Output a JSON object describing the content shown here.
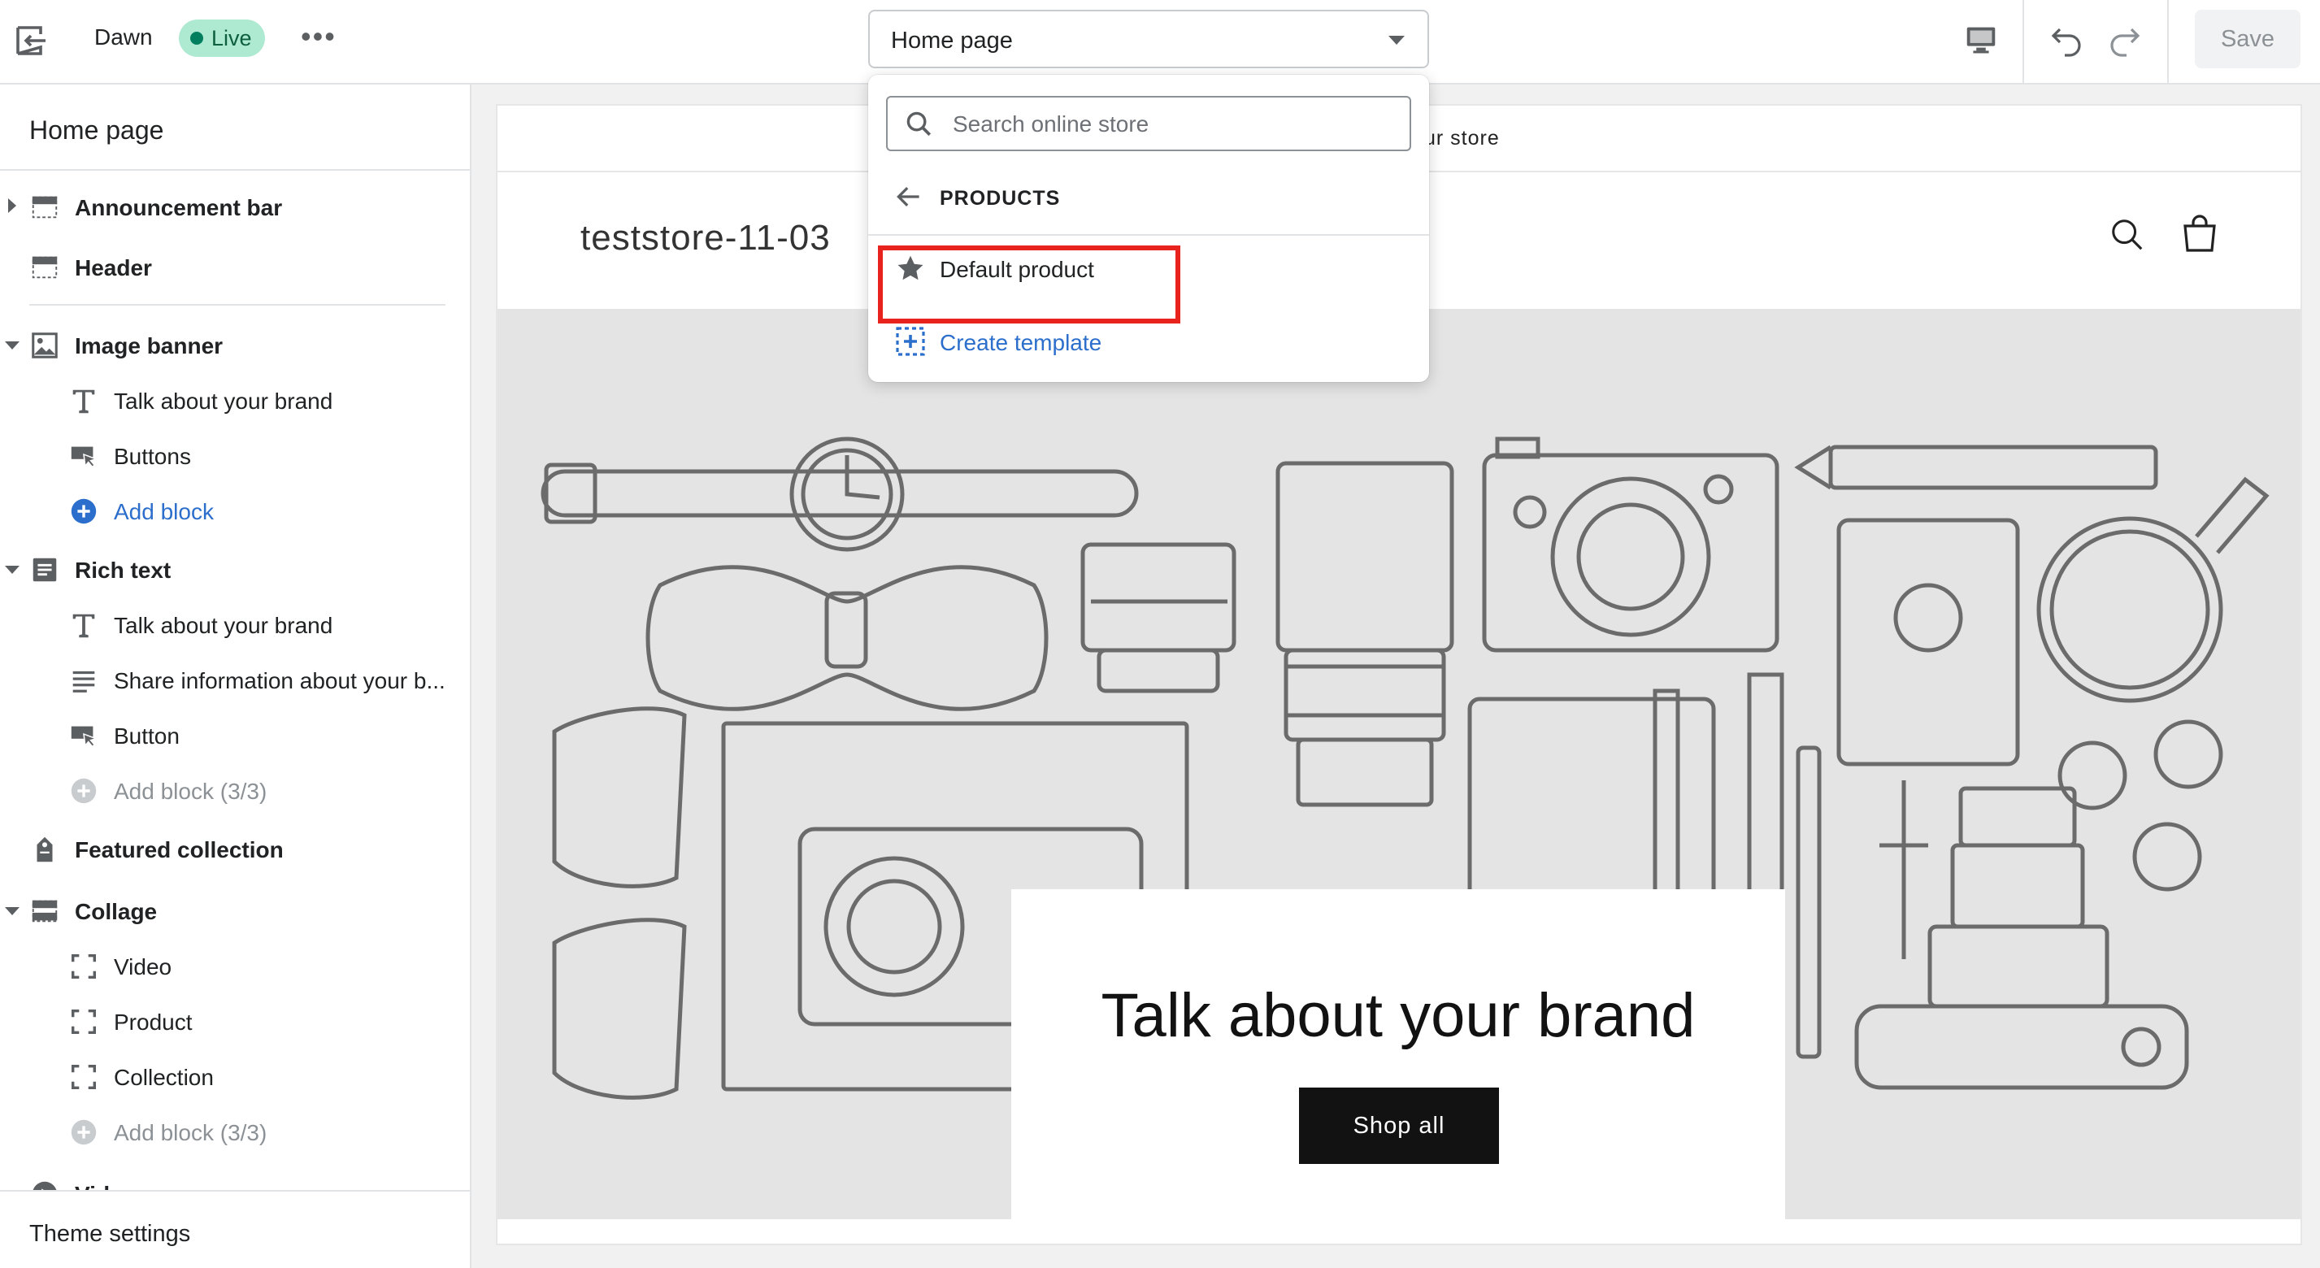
{
  "topbar": {
    "theme_name": "Dawn",
    "status_badge": "Live",
    "more_label": "•••",
    "page_selector": "Home page",
    "save_label": "Save"
  },
  "dropdown": {
    "search_placeholder": "Search online store",
    "back_label": "PRODUCTS",
    "items": [
      {
        "label": "Default product",
        "icon": "star-icon"
      }
    ],
    "create_label": "Create template"
  },
  "sidebar": {
    "title": "Home page",
    "sections": [
      {
        "label": "Announcement bar",
        "icon": "section-announcement-icon",
        "expanded": false,
        "blocks": []
      },
      {
        "label": "Header",
        "icon": "section-header-icon",
        "blocks": []
      },
      {
        "label": "Image banner",
        "icon": "image-icon",
        "expanded": true,
        "blocks": [
          {
            "label": "Talk about your brand",
            "icon": "text-icon"
          },
          {
            "label": "Buttons",
            "icon": "button-icon"
          },
          {
            "label": "Add block",
            "icon": "add-icon",
            "type": "add"
          }
        ]
      },
      {
        "label": "Rich text",
        "icon": "rich-text-icon",
        "expanded": true,
        "blocks": [
          {
            "label": "Talk about your brand",
            "icon": "text-icon"
          },
          {
            "label": "Share information about your b...",
            "icon": "paragraph-icon"
          },
          {
            "label": "Button",
            "icon": "button-icon"
          },
          {
            "label": "Add block (3/3)",
            "icon": "add-icon",
            "type": "disabled"
          }
        ]
      },
      {
        "label": "Featured collection",
        "icon": "tag-icon",
        "blocks": []
      },
      {
        "label": "Collage",
        "icon": "collage-icon",
        "expanded": true,
        "blocks": [
          {
            "label": "Video",
            "icon": "placeholder-icon"
          },
          {
            "label": "Product",
            "icon": "placeholder-icon"
          },
          {
            "label": "Collection",
            "icon": "placeholder-icon"
          },
          {
            "label": "Add block (3/3)",
            "icon": "add-icon",
            "type": "disabled"
          }
        ]
      },
      {
        "label": "Video",
        "icon": "video-icon",
        "blocks": []
      }
    ],
    "footer_label": "Theme settings"
  },
  "preview": {
    "announcement_partial": "ur store",
    "store_name": "teststore-11-03",
    "banner_heading": "Talk about your brand",
    "banner_button": "Shop all"
  },
  "colors": {
    "accent_blue": "#2c6ecb",
    "live_badge_bg": "#aee9d1",
    "highlight_red": "#e8231e"
  }
}
